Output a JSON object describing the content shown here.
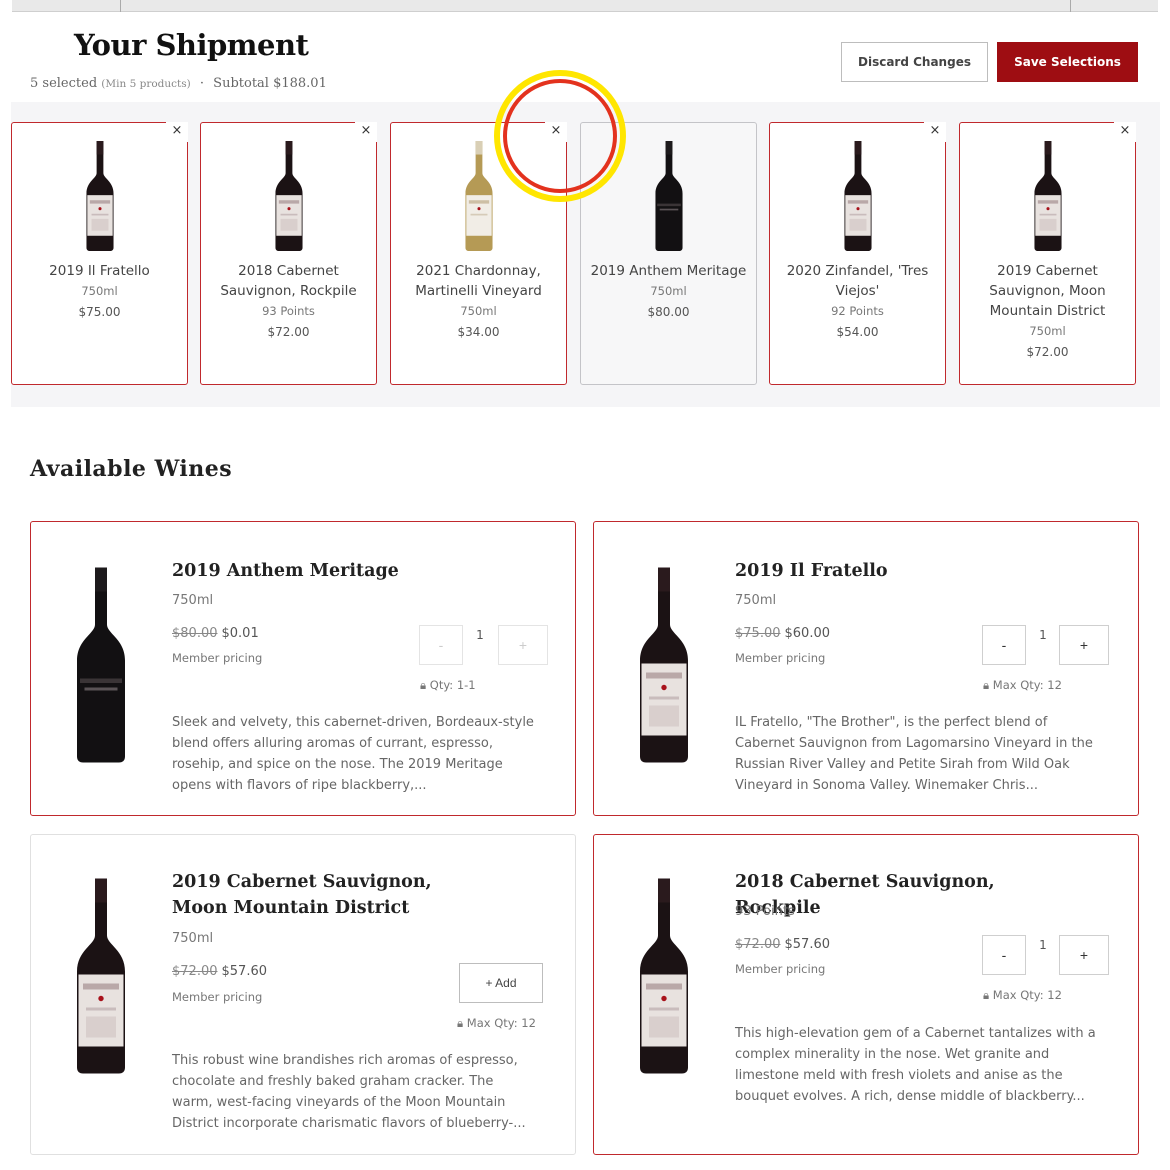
{
  "header": {
    "title": "Your Shipment",
    "selected": "5 selected",
    "min_note": "(Min 5 products)",
    "separator": "·",
    "subtotal": "Subtotal $188.01",
    "discard_label": "Discard Changes",
    "save_label": "Save Selections"
  },
  "shipment": [
    {
      "name": "2019 Il Fratello",
      "meta": "750ml",
      "price": "$75.00",
      "wine": "red"
    },
    {
      "name": "2018 Cabernet Sauvignon, Rockpile",
      "meta": "93 Points",
      "price": "$72.00",
      "wine": "red"
    },
    {
      "name": "2021 Chardonnay, Martinelli Vineyard",
      "meta": "750ml",
      "price": "$34.00",
      "wine": "white"
    },
    {
      "name": "2019 Anthem Meritage",
      "meta": "750ml",
      "price": "$80.00",
      "wine": "black"
    },
    {
      "name": "2020 Zinfandel, 'Tres Viejos'",
      "meta": "92 Points",
      "price": "$54.00",
      "wine": "red"
    },
    {
      "name": "2019 Cabernet Sauvignon, Moon Mountain District",
      "meta": "750ml",
      "price": "$72.00",
      "wine": "red"
    }
  ],
  "close_glyph": "×",
  "available": {
    "title": "Available Wines",
    "member_pricing": "Member pricing",
    "minus": "-",
    "plus": "+",
    "cards": [
      {
        "title": "2019 Anthem Meritage",
        "sub": "750ml",
        "old_price": "$80.00",
        "price": "$0.01",
        "qty": "1",
        "qty_note": "Qty: 1-1",
        "desc": "Sleek and velvety, this cabernet-driven, Bordeaux-style blend offers alluring aromas of currant, espresso, rosehip, and spice on the nose. The 2019 Meritage opens with flavors of ripe blackberry,..."
      },
      {
        "title": "2019 Il Fratello",
        "sub": "750ml",
        "old_price": "$75.00",
        "price": "$60.00",
        "qty": "1",
        "qty_note": "Max Qty: 12",
        "desc": "IL Fratello, \"The Brother\", is the perfect blend of Cabernet Sauvignon from Lagomarsino Vineyard in the Russian River Valley and Petite Sirah from Wild Oak Vineyard in Sonoma Valley.  Winemaker Chris..."
      },
      {
        "title": "2019 Cabernet Sauvignon, Moon Mountain District",
        "sub": "750ml",
        "old_price": "$72.00",
        "price": "$57.60",
        "add_label": "+ Add",
        "qty_note": "Max Qty: 12",
        "desc": "This robust wine brandishes rich aromas of espresso, chocolate and freshly baked graham cracker. The warm, west-facing vineyards of the Moon Mountain District incorporate charismatic flavors of blueberry-..."
      },
      {
        "title": "2018 Cabernet Sauvignon, Rockpile",
        "sub": "93 Points",
        "old_price": "$72.00",
        "price": "$57.60",
        "qty": "1",
        "qty_note": "Max Qty: 12",
        "desc": "This high-elevation gem of a Cabernet tantalizes with a complex minerality in the nose. Wet granite and limestone meld with fresh violets and anise as the bouquet evolves. A rich, dense middle of blackberry..."
      }
    ]
  },
  "colors": {
    "accent": "#9e0d12",
    "card_border": "#c0292d",
    "highlight_outer": "#ffe600",
    "highlight_inner": "#e3321e"
  }
}
